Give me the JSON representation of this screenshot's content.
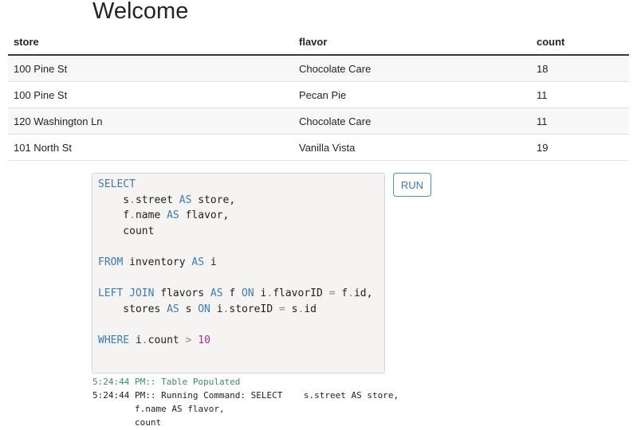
{
  "page": {
    "title": "Welcome"
  },
  "results": {
    "headers": [
      "store",
      "flavor",
      "count"
    ],
    "rows": [
      [
        "100 Pine St",
        "Chocolate Care",
        "18"
      ],
      [
        "100 Pine St",
        "Pecan Pie",
        "11"
      ],
      [
        "120 Washington Ln",
        "Chocolate Care",
        "11"
      ],
      [
        "101 North St",
        "Vanilla Vista",
        "19"
      ]
    ]
  },
  "editor": {
    "lines": [
      [
        {
          "t": "SELECT",
          "c": "kw"
        }
      ],
      [
        {
          "t": "    s",
          "c": ""
        },
        {
          "t": ".",
          "c": "op"
        },
        {
          "t": "street ",
          "c": ""
        },
        {
          "t": "AS",
          "c": "kw"
        },
        {
          "t": " store,",
          "c": ""
        }
      ],
      [
        {
          "t": "    f",
          "c": ""
        },
        {
          "t": ".",
          "c": "op"
        },
        {
          "t": "name ",
          "c": ""
        },
        {
          "t": "AS",
          "c": "kw"
        },
        {
          "t": " flavor,",
          "c": ""
        }
      ],
      [
        {
          "t": "    count",
          "c": ""
        }
      ],
      [],
      [
        {
          "t": "FROM",
          "c": "kw"
        },
        {
          "t": " inventory ",
          "c": ""
        },
        {
          "t": "AS",
          "c": "kw"
        },
        {
          "t": " i",
          "c": ""
        }
      ],
      [],
      [
        {
          "t": "LEFT JOIN",
          "c": "kw"
        },
        {
          "t": " flavors ",
          "c": ""
        },
        {
          "t": "AS",
          "c": "kw"
        },
        {
          "t": " f ",
          "c": ""
        },
        {
          "t": "ON",
          "c": "kw"
        },
        {
          "t": " i",
          "c": ""
        },
        {
          "t": ".",
          "c": "op"
        },
        {
          "t": "flavorID ",
          "c": ""
        },
        {
          "t": "=",
          "c": "op"
        },
        {
          "t": " f",
          "c": ""
        },
        {
          "t": ".",
          "c": "op"
        },
        {
          "t": "id,",
          "c": ""
        }
      ],
      [
        {
          "t": "    stores ",
          "c": ""
        },
        {
          "t": "AS",
          "c": "kw"
        },
        {
          "t": " s ",
          "c": ""
        },
        {
          "t": "ON",
          "c": "kw"
        },
        {
          "t": " i",
          "c": ""
        },
        {
          "t": ".",
          "c": "op"
        },
        {
          "t": "storeID ",
          "c": ""
        },
        {
          "t": "=",
          "c": "op"
        },
        {
          "t": " s",
          "c": ""
        },
        {
          "t": ".",
          "c": "op"
        },
        {
          "t": "id",
          "c": ""
        }
      ],
      [],
      [
        {
          "t": "WHERE",
          "c": "kw"
        },
        {
          "t": " i",
          "c": ""
        },
        {
          "t": ".",
          "c": "op"
        },
        {
          "t": "count ",
          "c": ""
        },
        {
          "t": ">",
          "c": "op"
        },
        {
          "t": " ",
          "c": ""
        },
        {
          "t": "10",
          "c": "num"
        }
      ]
    ]
  },
  "run_button": {
    "label": "RUN"
  },
  "log": {
    "lines": [
      {
        "text": "5:24:44 PM:: Table Populated",
        "kind": "success"
      },
      {
        "text": "5:24:44 PM:: Running Command: SELECT    s.street AS store,",
        "kind": "info"
      },
      {
        "text": "        f.name AS flavor,",
        "kind": "info"
      },
      {
        "text": "        count",
        "kind": "info"
      }
    ]
  }
}
